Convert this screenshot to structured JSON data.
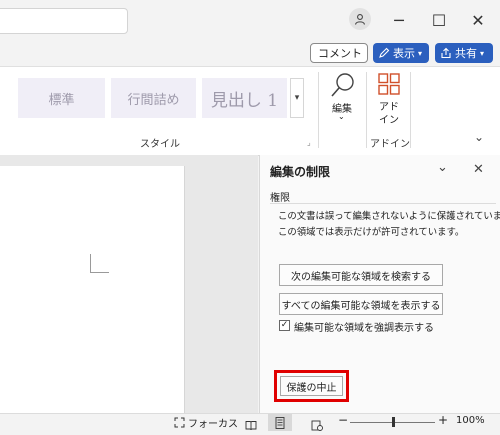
{
  "titlebar": {
    "avatar_icon": "person-icon",
    "minimize_glyph": "─",
    "maximize_glyph": "☐",
    "close_glyph": "✕"
  },
  "actions": {
    "comment_label": "コメント",
    "view_label": "表示",
    "share_label": "共有",
    "accent_color": "#2b5fbe"
  },
  "ribbon": {
    "styles": [
      {
        "label": "標準"
      },
      {
        "label": "行間詰め"
      },
      {
        "label": "見出し 1"
      }
    ],
    "style_group_label": "スタイル",
    "edit_label": "編集",
    "addin_label": "アド\nイン",
    "addin_group_label": "アドイン"
  },
  "pane": {
    "title": "編集の制限",
    "section_label": "権限",
    "message_line1": "この文書は誤って編集されないように保護されています。",
    "message_line2": "この領域では表示だけが許可されています。",
    "find_next_button": "次の編集可能な領域を検索する",
    "show_all_button": "すべての編集可能な領域を表示する",
    "highlight_checkbox_label": "編集可能な領域を強調表示する",
    "highlight_checked": true,
    "stop_protection_button": "保護の中止",
    "highlight_color": "#e00000"
  },
  "status": {
    "focus_label": "フォーカス",
    "zoom_minus": "−",
    "zoom_plus": "+",
    "zoom_level": "100%",
    "zoom_fraction": 0.5
  }
}
